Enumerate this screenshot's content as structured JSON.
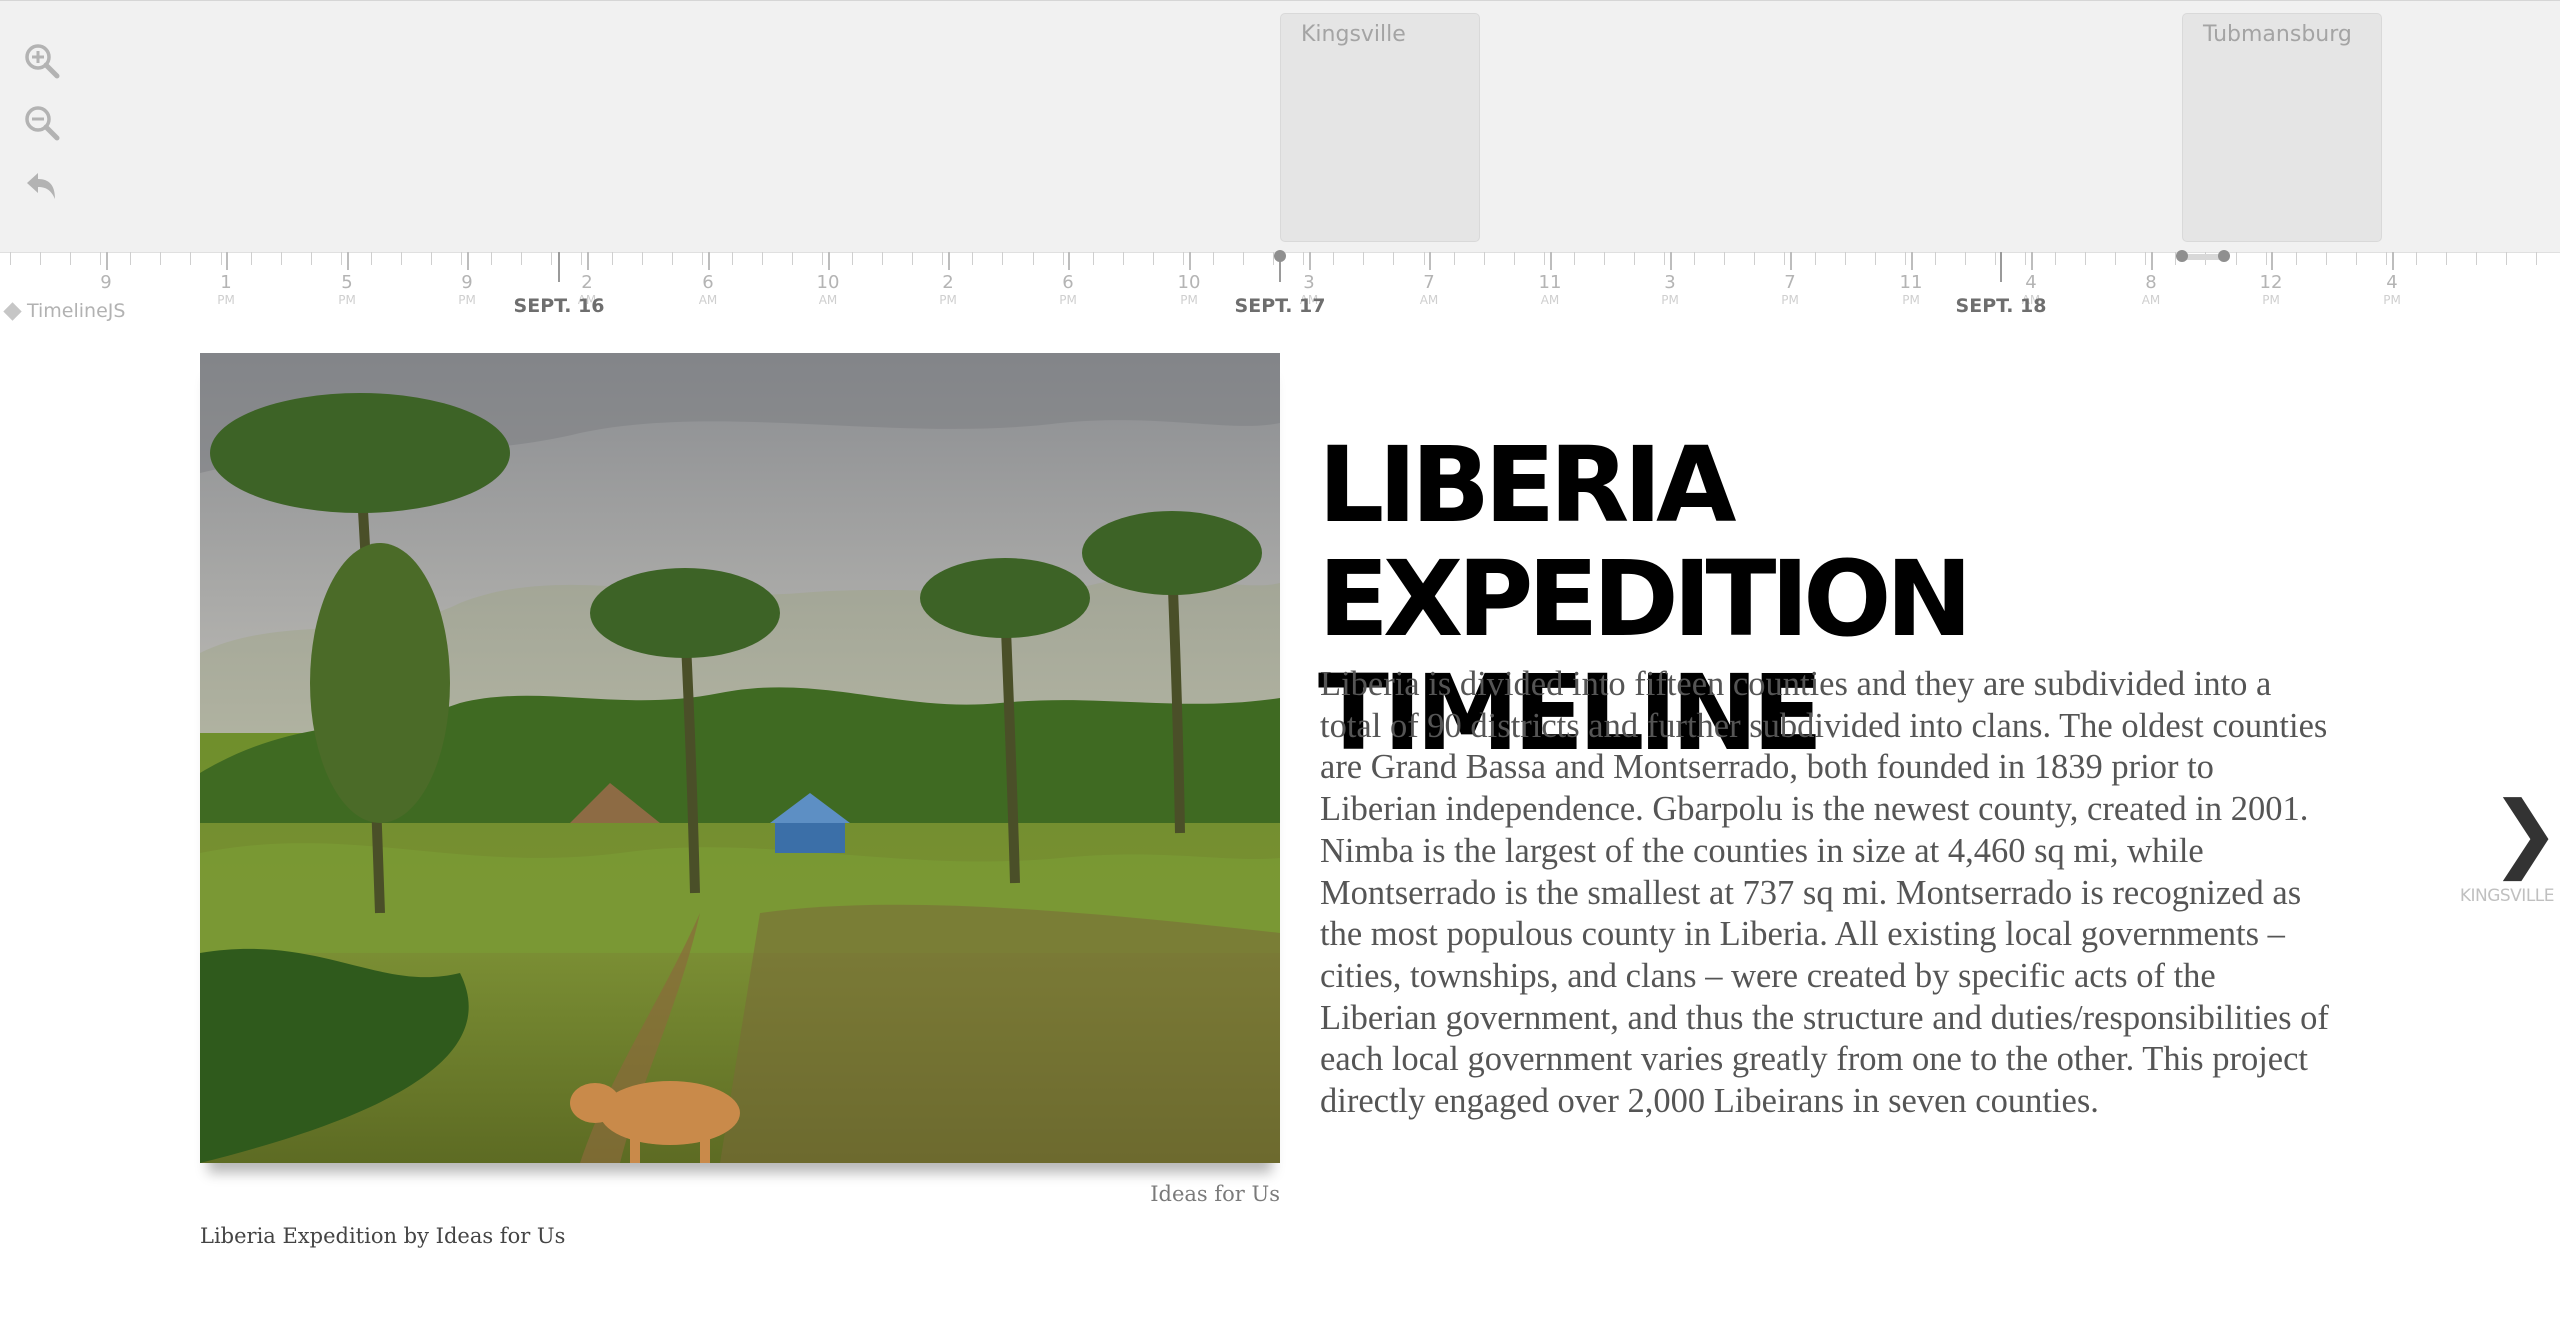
{
  "branding": {
    "name": "TimelineJS"
  },
  "controls": {
    "zoom_in_icon": "zoom-in-icon",
    "zoom_out_icon": "zoom-out-icon",
    "back_icon": "back-arrow-icon"
  },
  "markers": [
    {
      "title": "Kingsville"
    },
    {
      "title": "Tubmansburg"
    }
  ],
  "axis": {
    "ticks": [
      {
        "num": "9",
        "ampm": ""
      },
      {
        "num": "1",
        "ampm": "PM"
      },
      {
        "num": "5",
        "ampm": "PM"
      },
      {
        "num": "9",
        "ampm": "PM"
      },
      {
        "num": "2",
        "ampm": "AM"
      },
      {
        "num": "6",
        "ampm": "AM"
      },
      {
        "num": "10",
        "ampm": "AM"
      },
      {
        "num": "2",
        "ampm": "PM"
      },
      {
        "num": "6",
        "ampm": "PM"
      },
      {
        "num": "10",
        "ampm": "PM"
      },
      {
        "num": "3",
        "ampm": "AM"
      },
      {
        "num": "7",
        "ampm": "AM"
      },
      {
        "num": "11",
        "ampm": "AM"
      },
      {
        "num": "3",
        "ampm": "PM"
      },
      {
        "num": "7",
        "ampm": "PM"
      },
      {
        "num": "11",
        "ampm": "PM"
      },
      {
        "num": "4",
        "ampm": "AM"
      },
      {
        "num": "8",
        "ampm": "AM"
      },
      {
        "num": "12",
        "ampm": "PM"
      },
      {
        "num": "4",
        "ampm": "PM"
      }
    ],
    "days": [
      {
        "label": "SEPT. 16"
      },
      {
        "label": "SEPT. 17"
      },
      {
        "label": "SEPT. 18"
      }
    ]
  },
  "slide": {
    "media_icon": "landscape-photo",
    "credit": "Ideas for Us",
    "caption": "Liberia Expedition by Ideas for Us",
    "headline": "LIBERIA EXPEDITION TIMELINE",
    "text": "Liberia is divided into fifteen counties and they are subdivided into a total of 90 districts and further subdivided into clans. The oldest counties are Grand Bassa and Montserrado, both founded in 1839 prior to Liberian independence. Gbarpolu is the newest county, created in 2001. Nimba is the largest of the counties in size at 4,460 sq mi, while Montserrado is the smallest at 737 sq mi. Montserrado is recognized as the most populous county in Liberia. All existing local governments – cities, townships, and clans – were created by specific acts of the Liberian government, and thus the structure and duties/responsibilities of each local government varies greatly from one to the other. This project directly engaged over 2,000 Libeirans in seven counties."
  },
  "navigation": {
    "next_icon": "chevron-right-icon",
    "next_title": "KINGSVILLE"
  }
}
